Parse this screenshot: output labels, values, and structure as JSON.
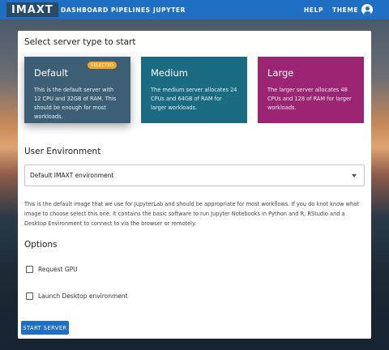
{
  "header": {
    "logo": "IMAXT",
    "nav": {
      "dashboard": "DASHBOARD",
      "pipelines": "PIPELINES",
      "jupyter": "JUPYTER",
      "help": "HELP",
      "theme": "THEME"
    },
    "account_icon": "account-circle-icon"
  },
  "main": {
    "title": "Select server type to start",
    "server_types": [
      {
        "name": "Default",
        "badge": "SELECTED",
        "description": "This is the default server with 12 CPU and 32GB of RAM. This should be enough for most workloads.",
        "color": "#3d5f75"
      },
      {
        "name": "Medium",
        "description": "The medium server allocates 24 CPUs and 64GB of RAM for larger workloads.",
        "color": "#1b6b82"
      },
      {
        "name": "Large",
        "description": "The larger server allocates 48 CPUs and 128 of RAM for larger workloads.",
        "color": "#9b2573"
      }
    ],
    "environment": {
      "label": "User Environment",
      "selected": "Default IMAXT environment",
      "description": "This is the default image that we use for JupyterLab and should be appropriate for most workflows. If you do knot know what image to choose select this one. It contains the basic software to run Jupyter Notebooks in Python and R, RStudio and a Desktop Environment to connect to via the browser or remotely."
    },
    "options": {
      "label": "Options",
      "request_gpu": "Request GPU",
      "launch_desktop": "Launch Desktop environment"
    },
    "start_button": "START SERVER"
  },
  "colors": {
    "accent": "#1f6fc4",
    "badge": "#f5a623"
  }
}
